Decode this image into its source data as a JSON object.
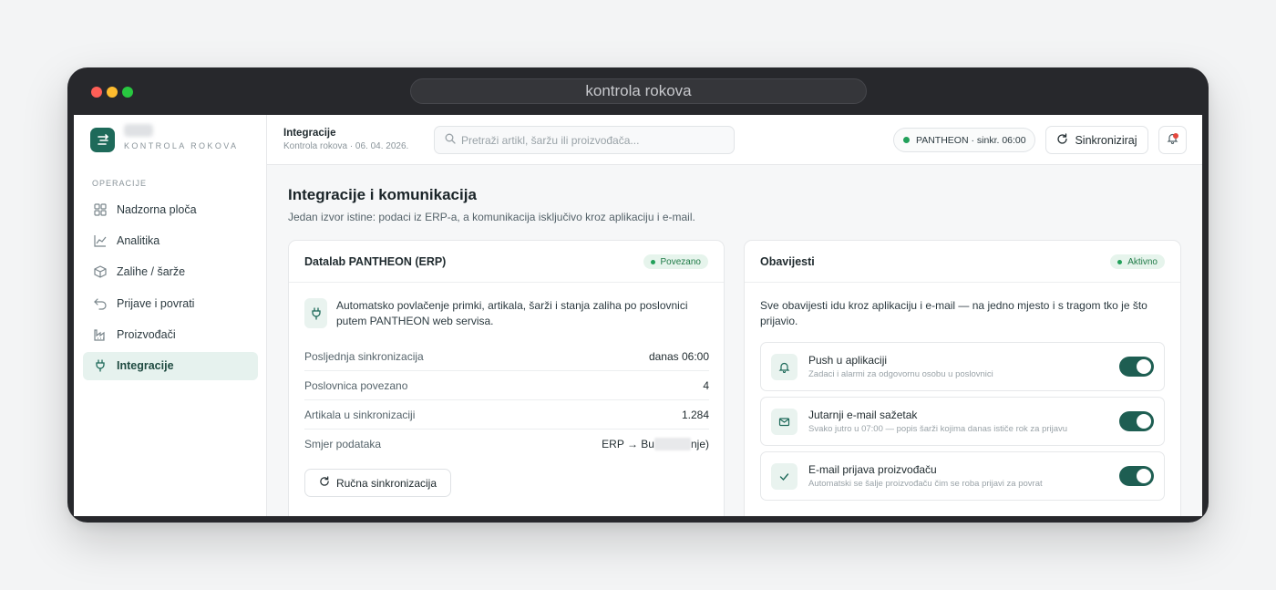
{
  "browser": {
    "url": "kontrola rokova"
  },
  "sidebar": {
    "brand_name": "••••",
    "brand_sub": "KONTROLA ROKOVA",
    "section": "OPERACIJE",
    "items": [
      {
        "label": "Nadzorna ploča",
        "icon": "dashboard-icon"
      },
      {
        "label": "Analitika",
        "icon": "chart-line-icon"
      },
      {
        "label": "Zalihe / šarže",
        "icon": "box-icon"
      },
      {
        "label": "Prijave i povrati",
        "icon": "return-icon"
      },
      {
        "label": "Proizvođači",
        "icon": "factory-icon"
      },
      {
        "label": "Integracije",
        "icon": "plug-icon",
        "active": true
      }
    ]
  },
  "header": {
    "title": "Integracije",
    "subtitle": "Kontrola rokova · 06. 04. 2026.",
    "search_placeholder": "Pretraži artikl, šaržu ili proizvođača...",
    "erp_status": "PANTHEON · sinkr. 06:00",
    "sync_label": "Sinkroniziraj"
  },
  "page": {
    "title": "Integracije i komunikacija",
    "subtitle": "Jedan izvor istine: podaci iz ERP-a, a komunikacija isključivo kroz aplikaciju i e-mail."
  },
  "erp": {
    "title": "Datalab PANTHEON (ERP)",
    "status": "Povezano",
    "description": "Automatsko povlačenje primki, artikala, šarži i stanja zaliha po poslovnici putem PANTHEON web servisa.",
    "rows": [
      {
        "key": "Posljednja sinkronizacija",
        "value": "danas 06:00"
      },
      {
        "key": "Poslovnica povezano",
        "value": "4"
      },
      {
        "key": "Artikala u sinkronizaciji",
        "value": "1.284"
      },
      {
        "key": "Smjer podataka",
        "value_start": "ERP → Bu",
        "value_end": "nje)"
      }
    ],
    "manual_sync_label": "Ručna sinkronizacija"
  },
  "notifications": {
    "title": "Obavijesti",
    "status": "Aktivno",
    "description": "Sve obavijesti idu kroz aplikaciju i e-mail — na jedno mjesto i s tragom tko je što prijavio.",
    "items": [
      {
        "title": "Push u aplikaciji",
        "subtitle": "Zadaci i alarmi za odgovornu osobu u poslovnici",
        "icon": "bell-icon",
        "enabled": true
      },
      {
        "title": "Jutarnji e-mail sažetak",
        "subtitle": "Svako jutro u 07:00 — popis šarži kojima danas ističe rok za prijavu",
        "icon": "mail-icon",
        "enabled": true
      },
      {
        "title": "E-mail prijava proizvođaču",
        "subtitle": "Automatski se šalje proizvođaču čim se roba prijavi za povrat",
        "icon": "check-icon",
        "enabled": true
      }
    ]
  },
  "colors": {
    "accent": "#1e6a5a",
    "success": "#22a05a",
    "toggle_on": "#1e5e52"
  }
}
